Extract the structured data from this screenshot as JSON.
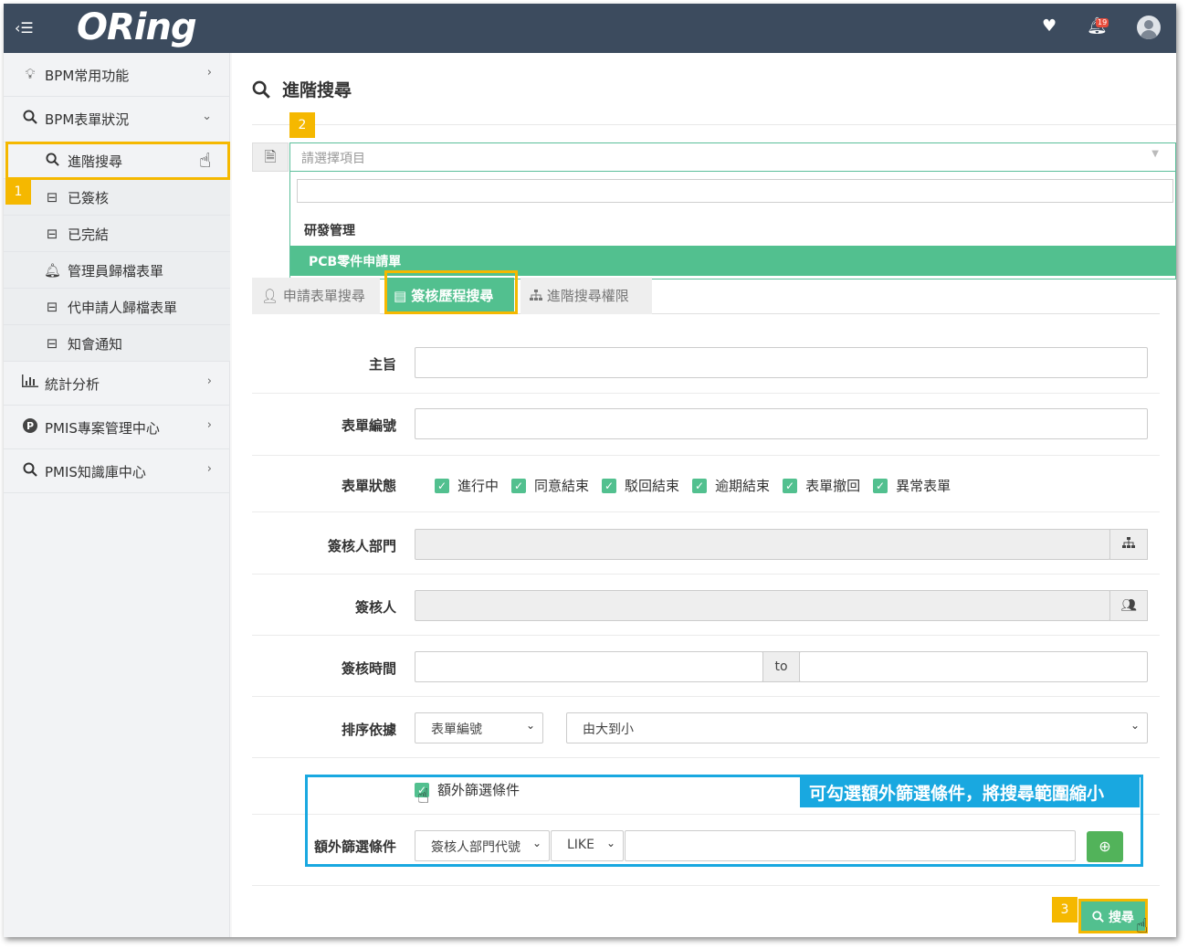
{
  "header": {
    "logo": "ORing",
    "notification_count": "19",
    "icons": [
      "menu-toggle-icon",
      "heart-icon",
      "bell-icon",
      "user-avatar-icon"
    ]
  },
  "sidebar": {
    "items": [
      {
        "label": "BPM常用功能",
        "icon": "lightbulb-icon"
      },
      {
        "label": "BPM表單狀況",
        "icon": "search-icon"
      },
      {
        "label": "統計分析",
        "icon": "bar-chart-icon"
      },
      {
        "label": "PMIS專案管理中心",
        "icon": "p-circle-icon"
      },
      {
        "label": "PMIS知識庫中心",
        "icon": "search-icon"
      }
    ],
    "sub_items": [
      {
        "label": "進階搜尋",
        "icon": "search-icon"
      },
      {
        "label": "已簽核",
        "icon": "inbox-icon"
      },
      {
        "label": "已完結",
        "icon": "inbox-icon"
      },
      {
        "label": "管理員歸檔表單",
        "icon": "bell-icon"
      },
      {
        "label": "代申請人歸檔表單",
        "icon": "inbox-icon"
      },
      {
        "label": "知會通知",
        "icon": "inbox-icon"
      }
    ]
  },
  "callouts": {
    "one": "1",
    "two": "2",
    "three": "3"
  },
  "main": {
    "title": "進階搜尋",
    "form_select": {
      "placeholder": "請選擇項目",
      "group": "研發管理",
      "option": "PCB零件申請單"
    },
    "tabs": [
      {
        "label": "申請表單搜尋",
        "icon": "user-icon"
      },
      {
        "label": "簽核歷程搜尋",
        "icon": "list-icon"
      },
      {
        "label": "進階搜尋權限",
        "icon": "sitemap-icon"
      }
    ],
    "fields": {
      "subject_label": "主旨",
      "form_no_label": "表單編號",
      "status_label": "表單狀態",
      "status_options": [
        "進行中",
        "同意結束",
        "駁回結束",
        "逾期結束",
        "表單撤回",
        "異常表單"
      ],
      "dept_label": "簽核人部門",
      "signer_label": "簽核人",
      "time_label": "簽核時間",
      "time_to": "to",
      "sort_label": "排序依據",
      "sort_field": "表單編號",
      "sort_order": "由大到小",
      "extra_check_label": "額外篩選條件",
      "extra_label": "額外篩選條件",
      "extra_field": "簽核人部門代號",
      "extra_operator": "LIKE"
    },
    "banner": "可勾選額外篩選條件，將搜尋範圍縮小",
    "search_button": "搜尋"
  },
  "colors": {
    "header_bg": "#3c4b5e",
    "accent_green": "#52c08f",
    "highlight_yellow": "#f5b800",
    "callout_blue": "#19a8e0"
  }
}
